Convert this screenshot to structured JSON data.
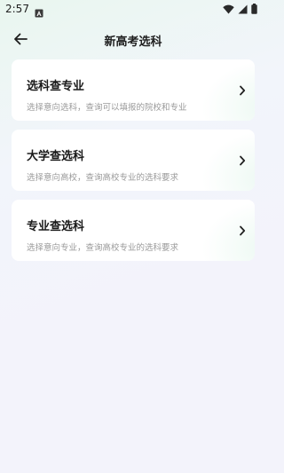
{
  "status_bar": {
    "time": "2:57",
    "icons": [
      "app-notification-icon",
      "wifi-icon",
      "signal-icon",
      "battery-icon"
    ]
  },
  "header": {
    "title": "新高考选科",
    "back_icon": "back-arrow-icon"
  },
  "cards": [
    {
      "title": "选科查专业",
      "subtitle": "选择意向选科，查询可以填报的院校和专业",
      "icon": "chevron-right-icon"
    },
    {
      "title": "大学查选科",
      "subtitle": "选择意向高校，查询高校专业的选科要求",
      "icon": "chevron-right-icon"
    },
    {
      "title": "专业查选科",
      "subtitle": "选择意向专业，查询高校专业的选科要求",
      "icon": "chevron-right-icon"
    }
  ],
  "colors": {
    "accent_tint": "#e4f5ec",
    "background": "#f3f3fb",
    "card": "#ffffff",
    "title_text": "#1a1a1a",
    "subtitle_text": "#9a9a9a"
  }
}
